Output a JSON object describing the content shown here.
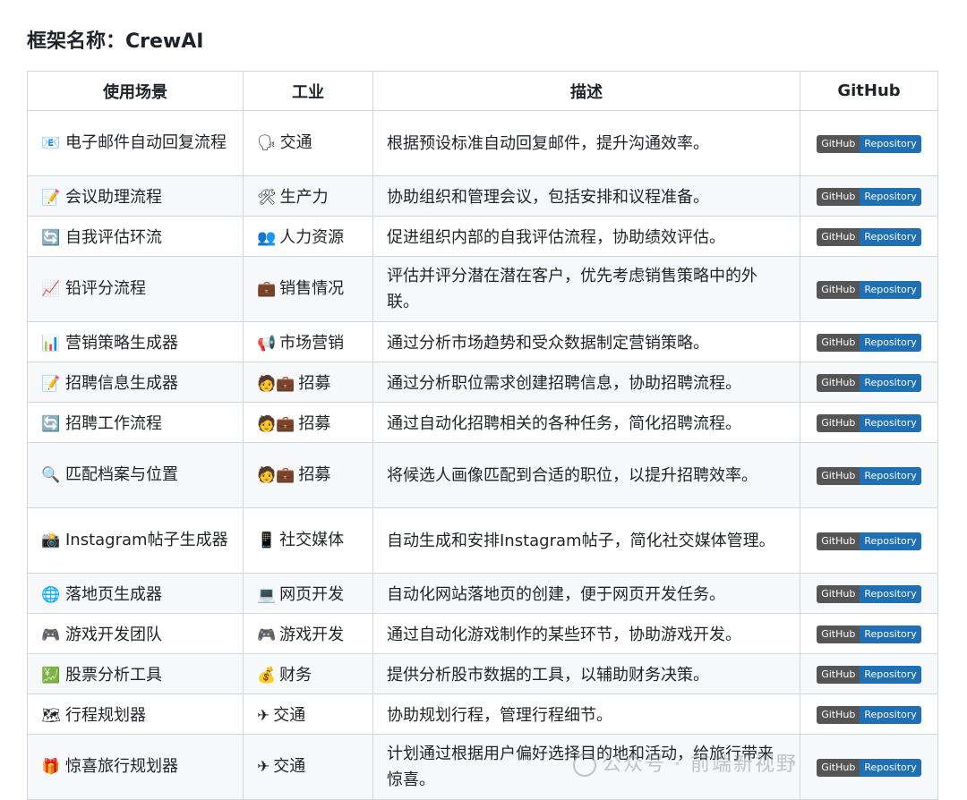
{
  "title": "框架名称：CrewAI",
  "headers": [
    "使用场景",
    "工业",
    "描述",
    "GitHub"
  ],
  "badge": {
    "left": "GitHub",
    "right": "Repository"
  },
  "rows": [
    {
      "icon": "📧",
      "icon_name": "email-icon",
      "scene": "电子邮件自动回复流程",
      "industry_icons": "🗣",
      "industry": "交通",
      "desc": "根据预设标准自动回复邮件，提升沟通效率。",
      "tall": true
    },
    {
      "icon": "📝",
      "icon_name": "memo-icon",
      "scene": "会议助理流程",
      "industry_icons": "🛠",
      "industry": "生产力",
      "desc": "协助组织和管理会议，包括安排和议程准备。",
      "tall": false
    },
    {
      "icon": "🔄",
      "icon_name": "cycle-icon",
      "scene": "自我评估环流",
      "industry_icons": "👥",
      "industry": "人力资源",
      "desc": "促进组织内部的自我评估流程，协助绩效评估。",
      "tall": false
    },
    {
      "icon": "📈",
      "icon_name": "chart-up-icon",
      "scene": "铅评分流程",
      "industry_icons": "💼",
      "industry": "销售情况",
      "desc": "评估并评分潜在潜在客户，优先考虑销售策略中的外联。",
      "tall": true
    },
    {
      "icon": "📊",
      "icon_name": "bar-chart-icon",
      "scene": "营销策略生成器",
      "industry_icons": "📢",
      "industry": "市场营销",
      "desc": "通过分析市场趋势和受众数据制定营销策略。",
      "tall": false
    },
    {
      "icon": "📝",
      "icon_name": "memo-icon",
      "scene": "招聘信息生成器",
      "industry_icons": "🧑💼",
      "industry": "招募",
      "desc": "通过分析职位需求创建招聘信息，协助招聘流程。",
      "tall": false
    },
    {
      "icon": "🔄",
      "icon_name": "cycle-icon",
      "scene": "招聘工作流程",
      "industry_icons": "🧑💼",
      "industry": "招募",
      "desc": "通过自动化招聘相关的各种任务，简化招聘流程。",
      "tall": false
    },
    {
      "icon": "🔍",
      "icon_name": "magnifier-icon",
      "scene": "匹配档案与位置",
      "industry_icons": "🧑💼",
      "industry": "招募",
      "desc": "将候选人画像匹配到合适的职位，以提升招聘效率。",
      "tall": true
    },
    {
      "icon": "📸",
      "icon_name": "camera-icon",
      "scene": "Instagram帖子生成器",
      "industry_icons": "📱",
      "industry": "社交媒体",
      "desc": "自动生成和安排Instagram帖子，简化社交媒体管理。",
      "tall": true
    },
    {
      "icon": "🌐",
      "icon_name": "globe-icon",
      "scene": "落地页生成器",
      "industry_icons": "💻",
      "industry": "网页开发",
      "desc": "自动化网站落地页的创建，便于网页开发任务。",
      "tall": false
    },
    {
      "icon": "🎮",
      "icon_name": "gamepad-icon",
      "scene": "游戏开发团队",
      "industry_icons": "🎮",
      "industry": "游戏开发",
      "desc": "通过自动化游戏制作的某些环节，协助游戏开发。",
      "tall": false
    },
    {
      "icon": "💹",
      "icon_name": "stock-chart-icon",
      "scene": "股票分析工具",
      "industry_icons": "💰",
      "industry": "财务",
      "desc": "提供分析股市数据的工具，以辅助财务决策。",
      "tall": false
    },
    {
      "icon": "🗺",
      "icon_name": "map-icon",
      "scene": "行程规划器",
      "industry_icons": "✈",
      "industry": "交通",
      "desc": "协助规划行程，管理行程细节。",
      "tall": false
    },
    {
      "icon": "🎁",
      "icon_name": "gift-icon",
      "scene": "惊喜旅行规划器",
      "industry_icons": "✈",
      "industry": "交通",
      "desc": "计划通过根据用户偏好选择目的地和活动，给旅行带来惊喜。",
      "tall": true
    }
  ],
  "watermark": "公众号 · 前端新视野"
}
